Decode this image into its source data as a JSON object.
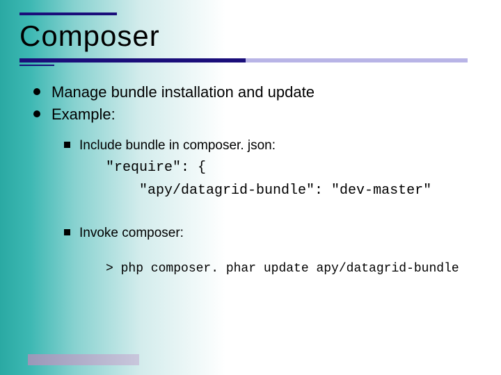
{
  "title": "Composer",
  "bullets_l1": [
    "Manage bundle installation and update",
    "Example:"
  ],
  "example": {
    "include_label": "Include bundle in composer. json:",
    "code_line1": "\"require\": {",
    "code_line2": "    \"apy/datagrid-bundle\": \"dev-master\"",
    "invoke_label": "Invoke composer:",
    "command": "> php composer. phar update apy/datagrid-bundle"
  }
}
